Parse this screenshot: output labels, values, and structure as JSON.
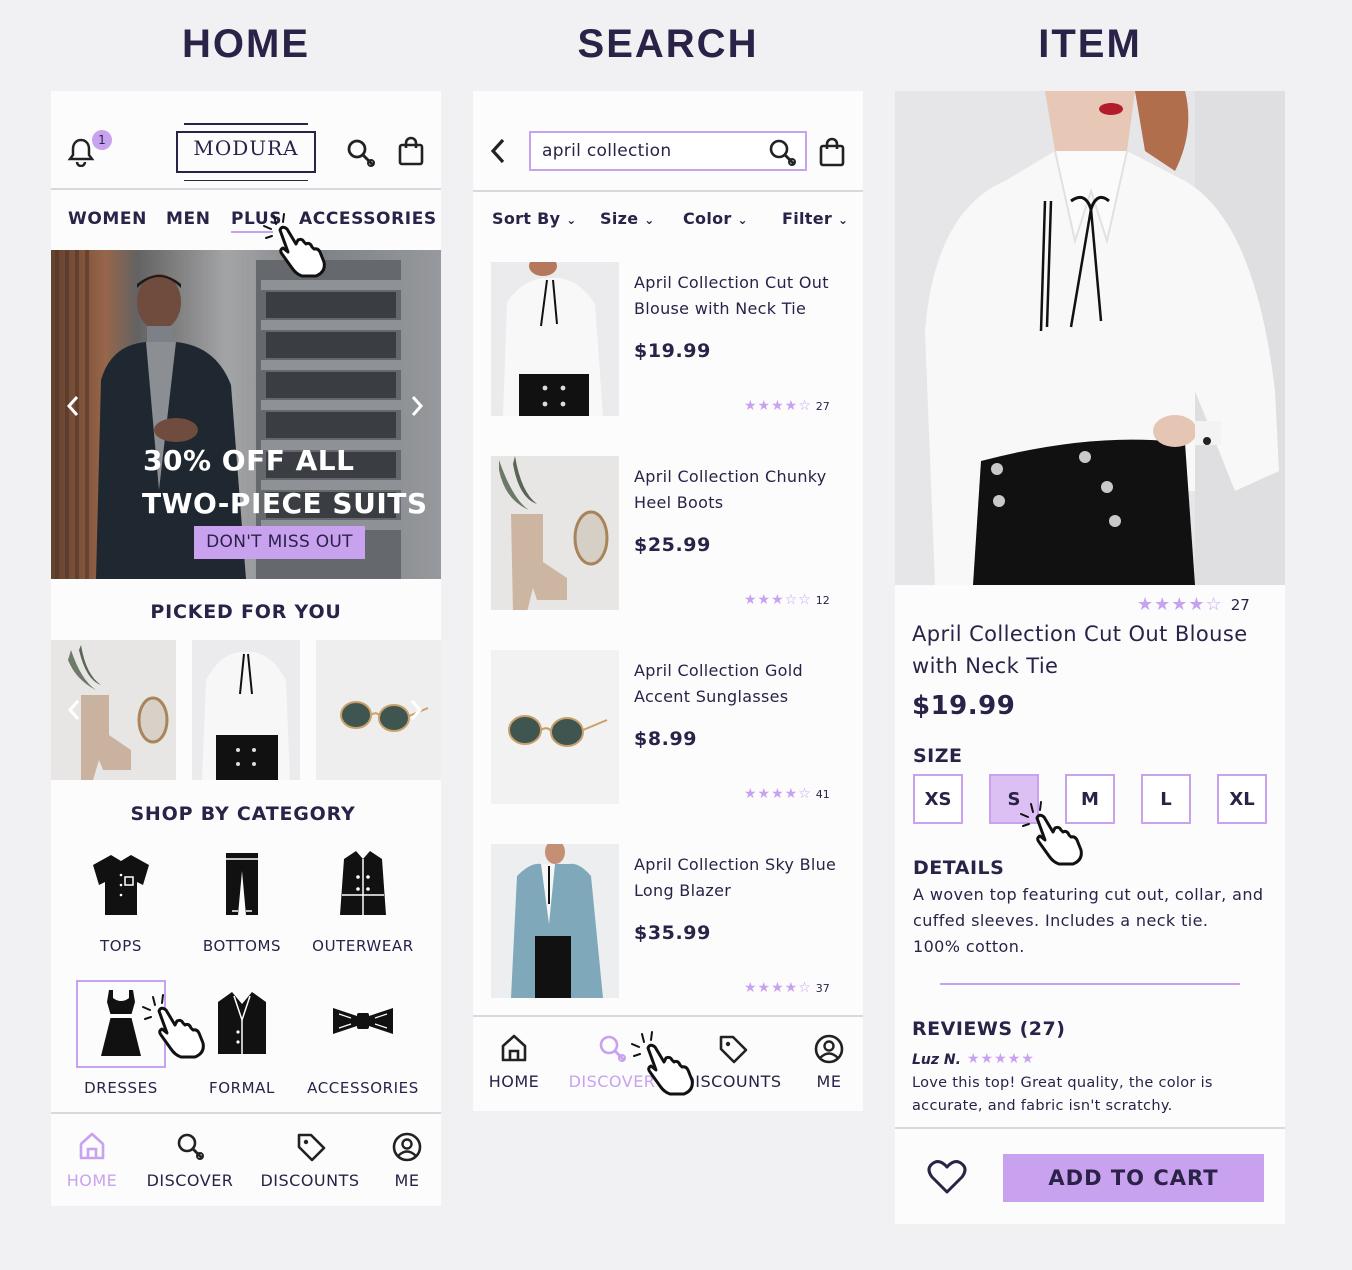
{
  "headings": {
    "home": "HOME",
    "search": "SEARCH",
    "item": "ITEM"
  },
  "colors": {
    "accent": "#c9a2ef",
    "accent_light": "#dcc0f3",
    "ink": "#2a2247",
    "bg": "#f1f0f2"
  },
  "home": {
    "notification_count": "1",
    "logo_text": "MODURA",
    "tabs": [
      "WOMEN",
      "MEN",
      "PLUS",
      "ACCESSORIES"
    ],
    "banner": {
      "line1": "30% OFF ALL",
      "line2": "TWO-PIECE SUITS",
      "cta": "DON'T MISS OUT"
    },
    "picked_title": "PICKED FOR YOU",
    "category_title": "SHOP BY CATEGORY",
    "categories": [
      "TOPS",
      "BOTTOMS",
      "OUTERWEAR",
      "DRESSES",
      "FORMAL",
      "ACCESSORIES"
    ],
    "nav": [
      "HOME",
      "DISCOVER",
      "DISCOUNTS",
      "ME"
    ]
  },
  "search": {
    "query": "april collection",
    "filters": [
      "Sort By",
      "Size",
      "Color",
      "Filter"
    ],
    "results": [
      {
        "title": "April Collection Cut Out Blouse with Neck Tie",
        "price": "$19.99",
        "rating": 4,
        "count": "27"
      },
      {
        "title": "April Collection Chunky Heel Boots",
        "price": "$25.99",
        "rating": 3,
        "count": "12"
      },
      {
        "title": "April Collection Gold Accent Sunglasses",
        "price": "$8.99",
        "rating": 4,
        "count": "41"
      },
      {
        "title": "April Collection Sky Blue Long Blazer",
        "price": "$35.99",
        "rating": 4,
        "count": "37"
      }
    ],
    "nav": [
      "HOME",
      "DISCOVER",
      "DISCOUNTS",
      "ME"
    ]
  },
  "item": {
    "rating": 4,
    "rating_count": "27",
    "title_line1": "April Collection Cut Out Blouse",
    "title_line2": "with Neck Tie",
    "price": "$19.99",
    "size_label": "SIZE",
    "sizes": [
      "XS",
      "S",
      "M",
      "L",
      "XL"
    ],
    "selected_size": "S",
    "details_label": "DETAILS",
    "details_line1": "A woven top featuring cut out, collar, and",
    "details_line2": "cuffed sleeves. Includes a neck tie.",
    "details_line3": "100% cotton.",
    "reviews_label": "REVIEWS (27)",
    "review_author": "Luz N.",
    "review_line1": "Love this top! Great quality, the color is",
    "review_line2": "accurate, and fabric isn't scratchy.",
    "add_to_cart": "ADD TO CART"
  }
}
